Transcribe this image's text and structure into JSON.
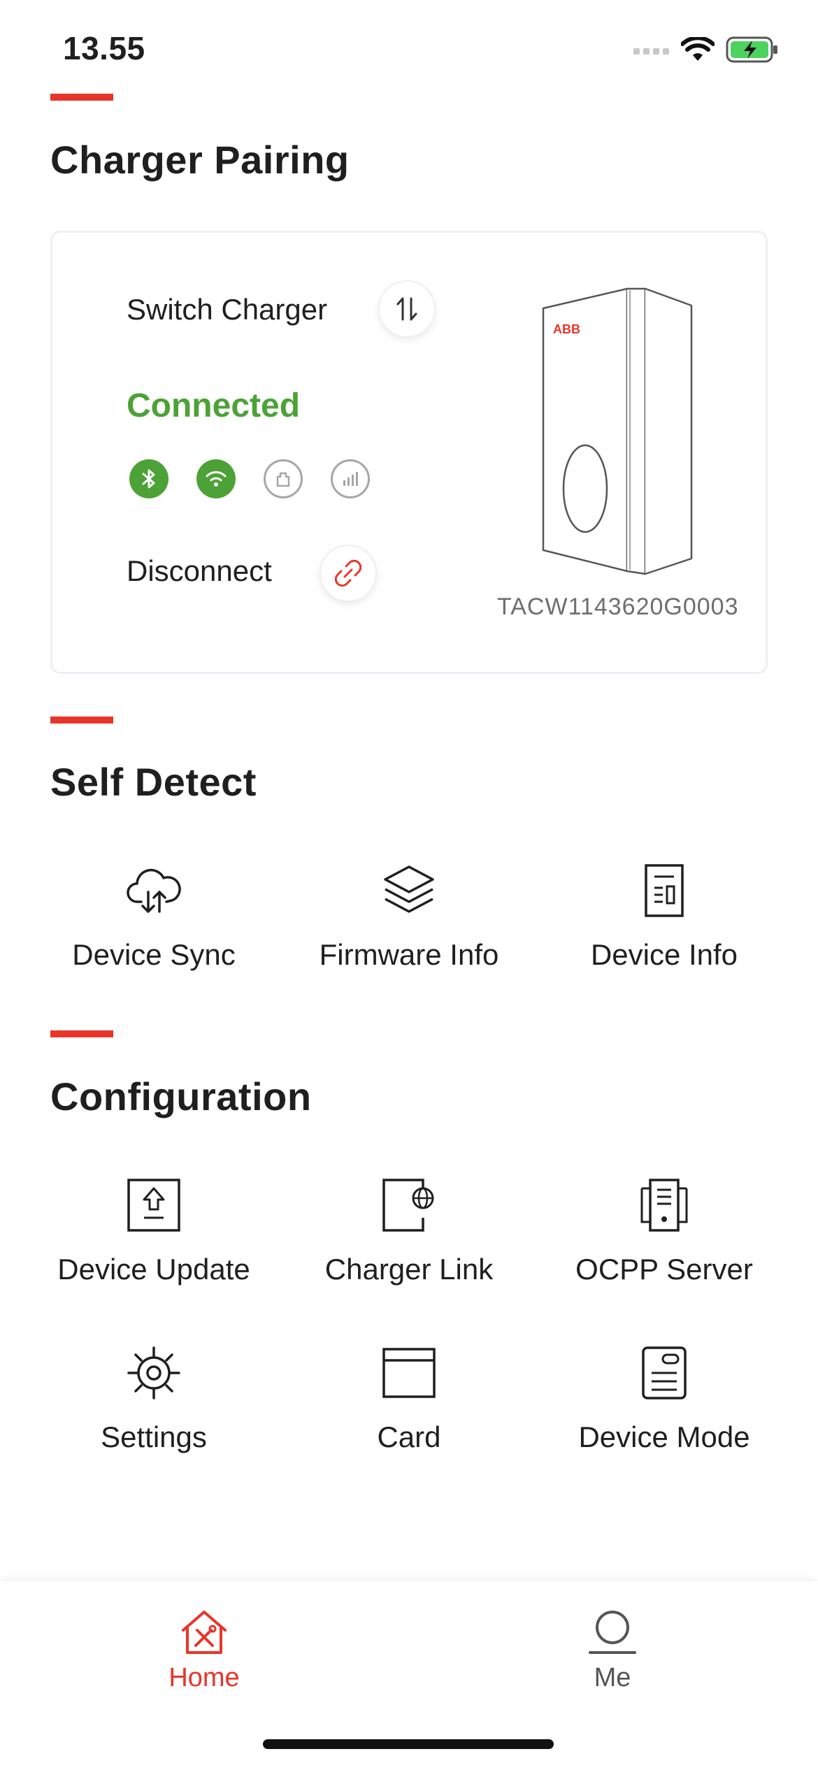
{
  "status_bar": {
    "time": "13.55"
  },
  "colors": {
    "accent": "#e8352a",
    "connected": "#4ca236",
    "text": "#1f1f1f",
    "muted": "#6e6e6e"
  },
  "charger_pairing": {
    "title": "Charger Pairing",
    "switch_label": "Switch Charger",
    "status": "Connected",
    "connectivity": [
      {
        "icon": "bluetooth-icon",
        "active": true
      },
      {
        "icon": "wifi-icon",
        "active": true
      },
      {
        "icon": "ethernet-icon",
        "active": false
      },
      {
        "icon": "cellular-icon",
        "active": false
      }
    ],
    "disconnect_label": "Disconnect",
    "charger_brand": "ABB",
    "serial": "TACW1143620G0003"
  },
  "self_detect": {
    "title": "Self Detect",
    "items": [
      {
        "label": "Device Sync",
        "icon": "cloud-sync-icon"
      },
      {
        "label": "Firmware Info",
        "icon": "layers-icon"
      },
      {
        "label": "Device Info",
        "icon": "document-icon"
      }
    ]
  },
  "configuration": {
    "title": "Configuration",
    "items": [
      {
        "label": "Device Update",
        "icon": "upload-box-icon"
      },
      {
        "label": "Charger Link",
        "icon": "globe-document-icon"
      },
      {
        "label": "OCPP Server",
        "icon": "server-icon"
      },
      {
        "label": "Settings",
        "icon": "gear-icon"
      },
      {
        "label": "Card",
        "icon": "card-icon"
      },
      {
        "label": "Device Mode",
        "icon": "device-mode-icon"
      }
    ]
  },
  "tabbar": {
    "items": [
      {
        "label": "Home",
        "icon": "home-tools-icon",
        "active": true
      },
      {
        "label": "Me",
        "icon": "person-icon",
        "active": false
      }
    ]
  }
}
